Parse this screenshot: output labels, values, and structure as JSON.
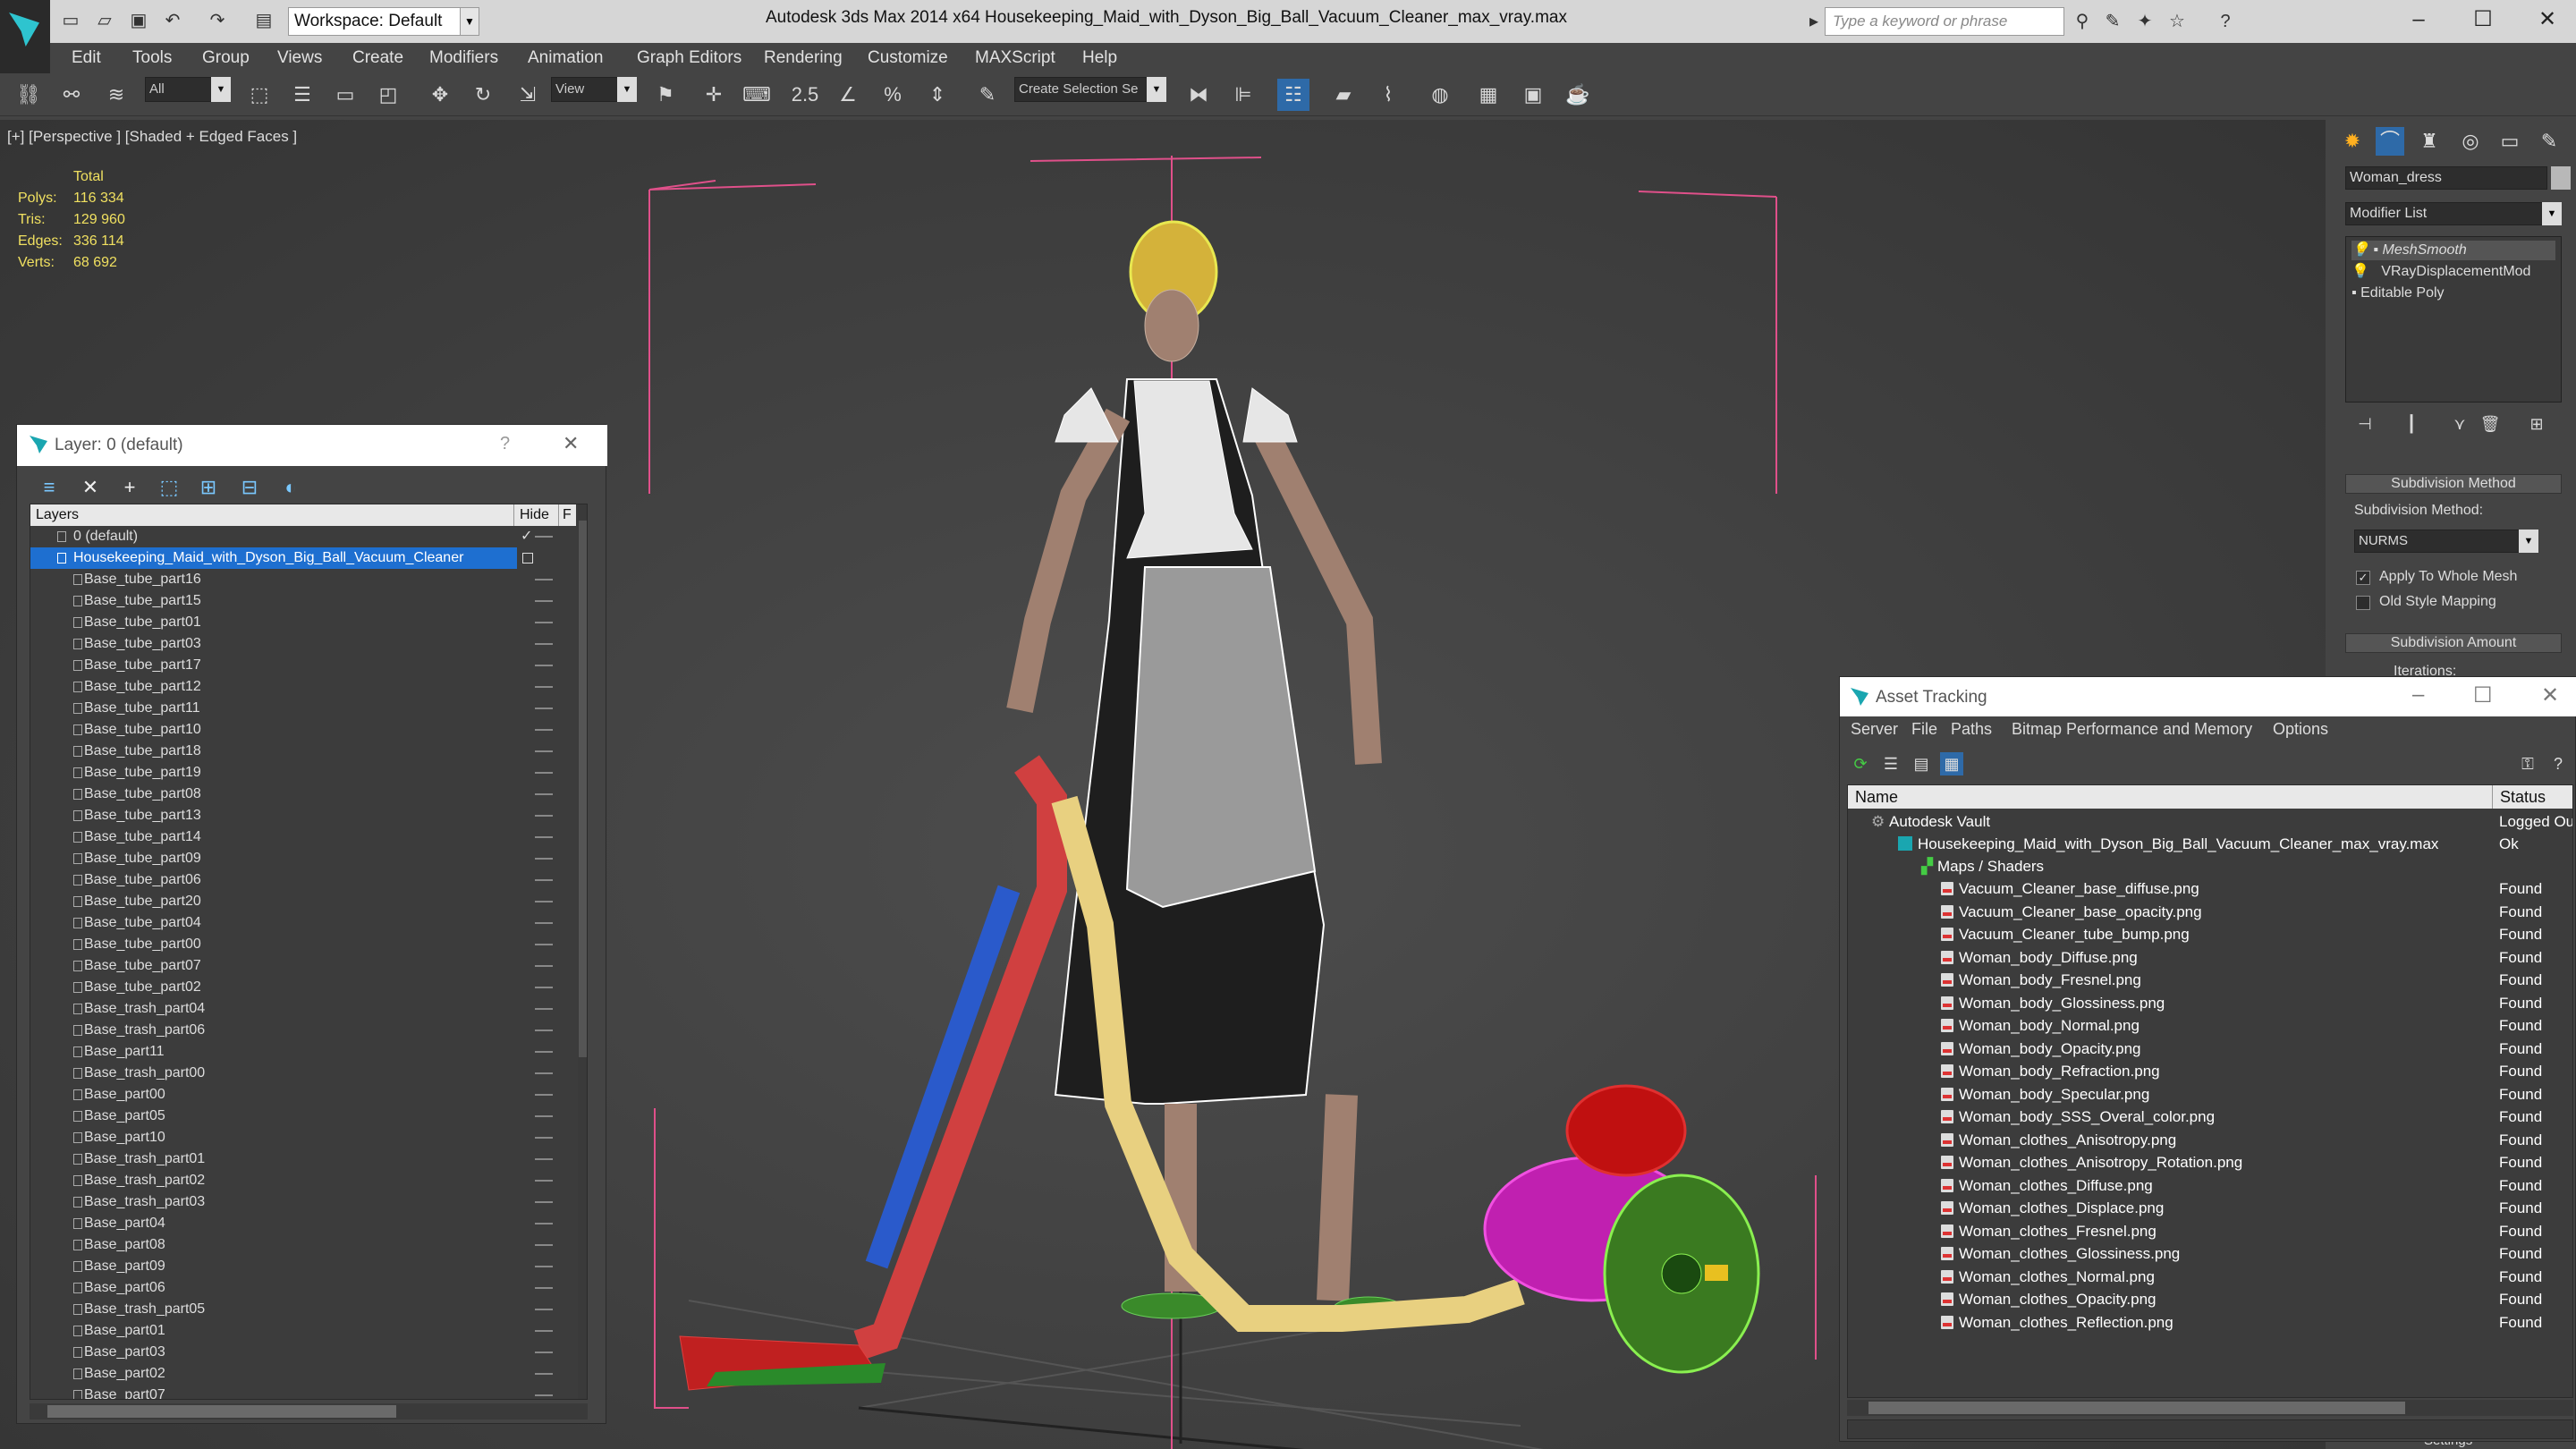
{
  "window": {
    "title": "Autodesk 3ds Max  2014 x64      Housekeeping_Maid_with_Dyson_Big_Ball_Vacuum_Cleaner_max_vray.max",
    "workspace": "Workspace: Default",
    "search_placeholder": "Type a keyword or phrase"
  },
  "menu": [
    "Edit",
    "Tools",
    "Group",
    "Views",
    "Create",
    "Modifiers",
    "Animation",
    "Graph Editors",
    "Rendering",
    "Customize",
    "MAXScript",
    "Help"
  ],
  "toolbar": {
    "selection_filter": "All",
    "ref_coord": "View",
    "snap_value": "2.5",
    "selection_set": "Create Selection Se"
  },
  "viewport": {
    "label": "[+] [Perspective ] [Shaded + Edged Faces ]",
    "stats": {
      "total_label": "Total",
      "polys_label": "Polys:",
      "polys": "116 334",
      "tris_label": "Tris:",
      "tris": "129 960",
      "edges_label": "Edges:",
      "edges": "336 114",
      "verts_label": "Verts:",
      "verts": "68 692"
    }
  },
  "layer_panel": {
    "title": "Layer: 0 (default)",
    "help": "?",
    "columns": {
      "layers": "Layers",
      "hide": "Hide",
      "f": "F"
    },
    "layers": [
      {
        "name": "0 (default)",
        "checked": true
      },
      {
        "name": "Housekeeping_Maid_with_Dyson_Big_Ball_Vacuum_Cleaner",
        "selected": true
      }
    ],
    "objects": [
      "Base_tube_part16",
      "Base_tube_part15",
      "Base_tube_part01",
      "Base_tube_part03",
      "Base_tube_part17",
      "Base_tube_part12",
      "Base_tube_part11",
      "Base_tube_part10",
      "Base_tube_part18",
      "Base_tube_part19",
      "Base_tube_part08",
      "Base_tube_part13",
      "Base_tube_part14",
      "Base_tube_part09",
      "Base_tube_part06",
      "Base_tube_part20",
      "Base_tube_part04",
      "Base_tube_part00",
      "Base_tube_part07",
      "Base_tube_part02",
      "Base_trash_part04",
      "Base_trash_part06",
      "Base_part11",
      "Base_trash_part00",
      "Base_part00",
      "Base_part05",
      "Base_part10",
      "Base_trash_part01",
      "Base_trash_part02",
      "Base_trash_part03",
      "Base_part04",
      "Base_part08",
      "Base_part09",
      "Base_part06",
      "Base_trash_part05",
      "Base_part01",
      "Base_part03",
      "Base_part02",
      "Base_part07"
    ]
  },
  "command_panel": {
    "object_name": "Woman_dress",
    "modifier_list": "Modifier List",
    "stack": [
      "MeshSmooth",
      "VRayDisplacementMod",
      "Editable Poly"
    ],
    "subdivision_method_header": "Subdivision Method",
    "subdivision_method_label": "Subdivision Method:",
    "subdivision_method_value": "NURMS",
    "apply_whole_mesh": "Apply To Whole Mesh",
    "old_style_mapping": "Old Style Mapping",
    "subdivision_amount_header": "Subdivision Amount",
    "iterations_label": "Iterations:",
    "settings_label": "Settings"
  },
  "asset_tracking": {
    "title": "Asset Tracking",
    "menu": [
      "Server",
      "File",
      "Paths",
      "Bitmap Performance and Memory",
      "Options"
    ],
    "columns": {
      "name": "Name",
      "status": "Status"
    },
    "vault": {
      "name": "Autodesk Vault",
      "status": "Logged Ou"
    },
    "file": {
      "name": "Housekeeping_Maid_with_Dyson_Big_Ball_Vacuum_Cleaner_max_vray.max",
      "status": "Ok"
    },
    "maps_group": "Maps / Shaders",
    "maps": [
      {
        "name": "Vacuum_Cleaner_base_diffuse.png",
        "status": "Found"
      },
      {
        "name": "Vacuum_Cleaner_base_opacity.png",
        "status": "Found"
      },
      {
        "name": "Vacuum_Cleaner_tube_bump.png",
        "status": "Found"
      },
      {
        "name": "Woman_body_Diffuse.png",
        "status": "Found"
      },
      {
        "name": "Woman_body_Fresnel.png",
        "status": "Found"
      },
      {
        "name": "Woman_body_Glossiness.png",
        "status": "Found"
      },
      {
        "name": "Woman_body_Normal.png",
        "status": "Found"
      },
      {
        "name": "Woman_body_Opacity.png",
        "status": "Found"
      },
      {
        "name": "Woman_body_Refraction.png",
        "status": "Found"
      },
      {
        "name": "Woman_body_Specular.png",
        "status": "Found"
      },
      {
        "name": "Woman_body_SSS_Overal_color.png",
        "status": "Found"
      },
      {
        "name": "Woman_clothes_Anisotropy.png",
        "status": "Found"
      },
      {
        "name": "Woman_clothes_Anisotropy_Rotation.png",
        "status": "Found"
      },
      {
        "name": "Woman_clothes_Diffuse.png",
        "status": "Found"
      },
      {
        "name": "Woman_clothes_Displace.png",
        "status": "Found"
      },
      {
        "name": "Woman_clothes_Fresnel.png",
        "status": "Found"
      },
      {
        "name": "Woman_clothes_Glossiness.png",
        "status": "Found"
      },
      {
        "name": "Woman_clothes_Normal.png",
        "status": "Found"
      },
      {
        "name": "Woman_clothes_Opacity.png",
        "status": "Found"
      },
      {
        "name": "Woman_clothes_Reflection.png",
        "status": "Found"
      }
    ]
  },
  "colors": {
    "viewport_bg": "#444444",
    "selection_blue": "#1e6fd0",
    "stats_yellow": "#f0e060",
    "bbox_pink": "#e0508a"
  },
  "icons": [
    "app-logo-icon",
    "new-file-icon",
    "open-file-icon",
    "save-icon",
    "undo-icon",
    "redo-icon",
    "select-link-icon",
    "move-icon",
    "rotate-icon",
    "scale-icon",
    "snap-icon",
    "mirror-icon",
    "align-icon",
    "render-icon",
    "close-icon",
    "help-icon"
  ]
}
